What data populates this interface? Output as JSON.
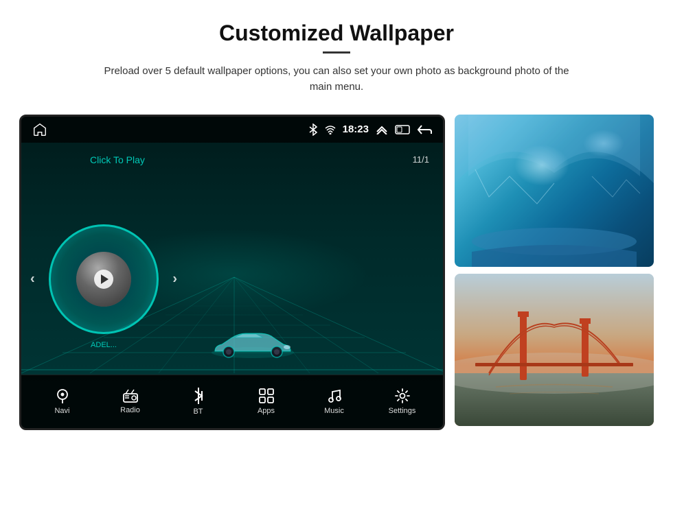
{
  "header": {
    "title": "Customized Wallpaper",
    "subtitle": "Preload over 5 default wallpaper options, you can also set your own photo as background photo of the main menu."
  },
  "screen": {
    "time": "18:23",
    "date": "11/1",
    "click_to_play": "Click To Play",
    "artist": "ADEL...",
    "bottom_nav": [
      {
        "label": "Navi",
        "icon": "location-icon"
      },
      {
        "label": "Radio",
        "icon": "radio-icon"
      },
      {
        "label": "BT",
        "icon": "bluetooth-icon"
      },
      {
        "label": "Apps",
        "icon": "apps-icon"
      },
      {
        "label": "Music",
        "icon": "music-icon"
      },
      {
        "label": "Settings",
        "icon": "settings-icon"
      }
    ]
  },
  "thumbnails": [
    {
      "id": "ice-cave",
      "alt": "Ice cave blue photo"
    },
    {
      "id": "golden-gate",
      "alt": "Golden Gate Bridge photo"
    }
  ]
}
